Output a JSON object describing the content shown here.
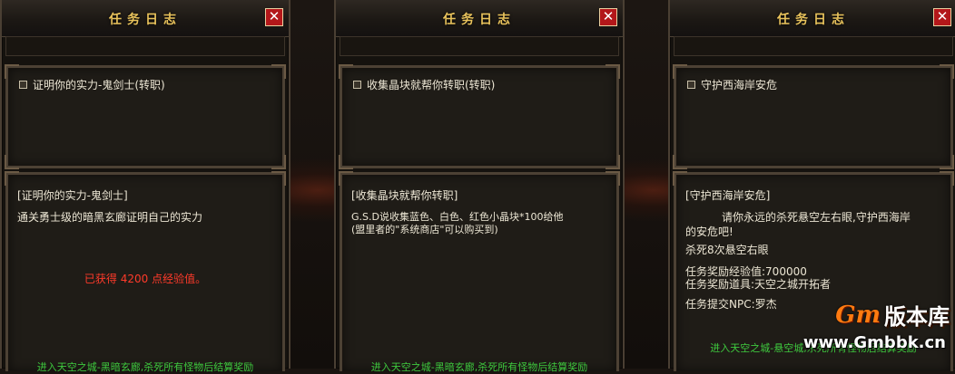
{
  "panels": [
    {
      "title": "任务日志",
      "close": "✕",
      "quest": "证明你的实力-鬼剑士(转职)",
      "detail_head": "[证明你的实力-鬼剑士]",
      "lines": [
        "通关勇士级的暗黑玄廊证明自己的实力"
      ],
      "reward": "已获得 4200 点经验值。",
      "footer": "进入天空之城-黑暗玄廊,杀死所有怪物后结算奖励"
    },
    {
      "title": "任务日志",
      "close": "✕",
      "quest": "收集晶块就帮你转职(转职)",
      "detail_head": "[收集晶块就帮你转职]",
      "lines": [
        "G.S.D说收集蓝色、白色、红色小晶块*100给他",
        "(盟里者的\"系统商店\"可以购买到)"
      ],
      "footer": "进入天空之城-黑暗玄廊,杀死所有怪物后结算奖励"
    },
    {
      "title": "任务日志",
      "close": "✕",
      "quest": "守护西海岸安危",
      "detail_head": "[守护西海岸安危]",
      "lines": [
        "请你永远的杀死悬空左右眼,守护西海岸",
        "的安危吧!",
        "杀死8次悬空右眼",
        "任务奖励经验值:700000",
        "任务奖励道具:天空之城开拓者",
        "任务提交NPC:罗杰"
      ],
      "footer": "进入天空之城-悬空城,杀死所有怪物后结算奖励"
    }
  ],
  "watermark": {
    "logo_gm": "Gm",
    "logo_text": "版本库",
    "url": "www.Gmbbk.cn"
  }
}
